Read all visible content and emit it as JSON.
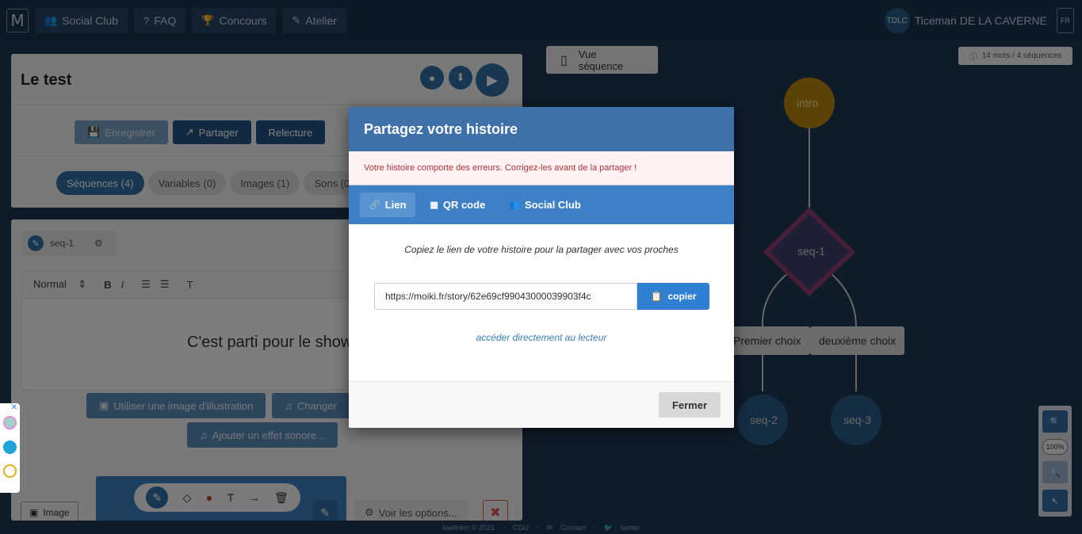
{
  "topbar": {
    "logo": "M",
    "nav": [
      {
        "label": "Social Club",
        "icon": "users-icon"
      },
      {
        "label": "FAQ",
        "icon": "question-icon"
      },
      {
        "label": "Concours",
        "icon": "trophy-icon"
      },
      {
        "label": "Atelier",
        "icon": "pencil-icon"
      }
    ],
    "user": {
      "initials": "TDLC",
      "name": "Ticeman DE LA CAVERNE",
      "lang": "FR"
    }
  },
  "editor": {
    "title": "Le test",
    "actions": [
      "Enregistrer",
      "Partager",
      "Relecture"
    ],
    "pills": [
      "Séquences (4)",
      "Variables (0)",
      "Images (1)",
      "Sons (0)"
    ],
    "sequence_name": "seq-1",
    "format_select": "Normal",
    "content_text": "C'est parti pour le show",
    "media_buttons": [
      "Utiliser une image d'illustration",
      "Changer"
    ],
    "sound_button": "Ajouter un effet sonore...",
    "image_button": "Image",
    "options_button": "Voir les options..."
  },
  "graph": {
    "view_button": "Vue séquence",
    "stats": "14 mots / 4 séquences",
    "nodes": {
      "intro": "intro",
      "seq1": "seq-1",
      "choice1": "Premier choix",
      "choice2": "deuxième choix",
      "seq2": "seq-2",
      "seq3": "seq-3"
    },
    "zoom_level": "100%"
  },
  "footer": {
    "copyright": "kaelhem © 2021",
    "cgu": "CGU",
    "contact": "Contact",
    "twitter": "twitter"
  },
  "modal": {
    "title": "Partagez votre histoire",
    "error": "Votre histoire comporte des erreurs. Corrigez-les avant de la partager !",
    "tabs": [
      {
        "label": "Lien",
        "icon": "link-icon",
        "active": true
      },
      {
        "label": "QR code",
        "icon": "qrcode-icon",
        "active": false
      },
      {
        "label": "Social Club",
        "icon": "users-icon",
        "active": false
      }
    ],
    "instruction": "Copiez le lien de votre histoire pour la partager avec vos proches",
    "link_value": "https://moiki.fr/story/62e69cf99043000039903f4c",
    "copy_label": "copier",
    "reader_link": "accéder directement au lecteur",
    "close_label": "Fermer"
  },
  "colors": {
    "primary": "#3e70aa",
    "tabs": "#3e80c8",
    "copy": "#2f7fd3",
    "error_text": "#b0343a",
    "background": "#1d3650"
  }
}
